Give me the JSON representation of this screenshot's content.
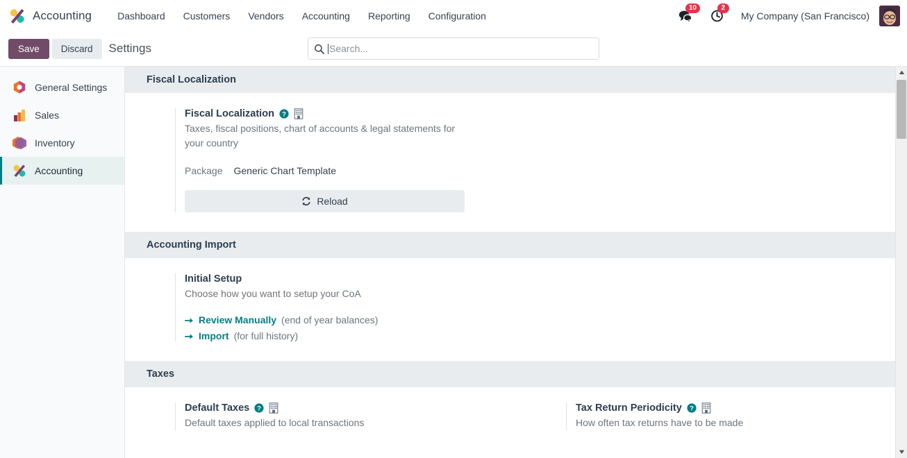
{
  "navbar": {
    "brand": "Accounting",
    "brand_logo_icon": "accounting-percent-logo",
    "menu": [
      {
        "label": "Dashboard"
      },
      {
        "label": "Customers"
      },
      {
        "label": "Vendors"
      },
      {
        "label": "Accounting"
      },
      {
        "label": "Reporting"
      },
      {
        "label": "Configuration"
      }
    ],
    "messages_icon": "chat-bubbles-icon",
    "messages_count": "10",
    "activities_icon": "clock-icon",
    "activities_count": "2",
    "company": "My Company (San Francisco)",
    "avatar_icon": "user-avatar",
    "badge_color": "#e4344a"
  },
  "control_panel": {
    "save_label": "Save",
    "discard_label": "Discard",
    "title": "Settings",
    "save_color": "#714b67"
  },
  "search": {
    "icon": "search-icon",
    "placeholder": "Search...",
    "value": ""
  },
  "sidebar": {
    "items": [
      {
        "label": "General Settings",
        "icon": "settings-hexagon-icon",
        "active": false
      },
      {
        "label": "Sales",
        "icon": "bar-chart-icon",
        "active": false
      },
      {
        "label": "Inventory",
        "icon": "inventory-hexagon-icon",
        "active": false
      },
      {
        "label": "Accounting",
        "icon": "accounting-percent-icon",
        "active": true
      }
    ],
    "active_color": "#017e84"
  },
  "sections": {
    "fiscal_localization": {
      "header": "Fiscal Localization",
      "setting": {
        "title": "Fiscal Localization",
        "help_icon": "question-mark-icon",
        "company_icon": "building-icon",
        "description": "Taxes, fiscal positions, chart of accounts & legal statements for your country",
        "package_label": "Package",
        "package_value": "Generic Chart Template",
        "reload_label": "Reload",
        "reload_icon": "refresh-icon"
      }
    },
    "accounting_import": {
      "header": "Accounting Import",
      "setting": {
        "title": "Initial Setup",
        "description": "Choose how you want to setup your CoA",
        "links": [
          {
            "icon": "arrow-right-icon",
            "label": "Review Manually",
            "note": "(end of year balances)"
          },
          {
            "icon": "arrow-right-icon",
            "label": "Import",
            "note": "(for full history)"
          }
        ]
      }
    },
    "taxes": {
      "header": "Taxes",
      "settings": [
        {
          "title": "Default Taxes",
          "help_icon": "question-mark-icon",
          "company_icon": "building-icon",
          "description": "Default taxes applied to local transactions"
        },
        {
          "title": "Tax Return Periodicity",
          "help_icon": "question-mark-icon",
          "company_icon": "building-icon",
          "description": "How often tax returns have to be made"
        }
      ]
    }
  },
  "scrollbar": {
    "up_icon": "caret-up-icon",
    "down_icon": "caret-down-icon"
  }
}
